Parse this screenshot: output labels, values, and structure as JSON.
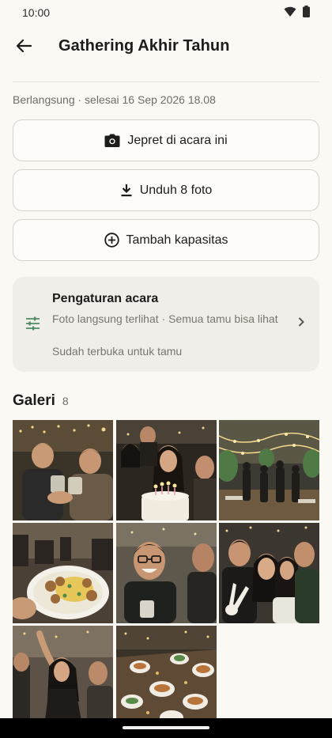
{
  "status_bar": {
    "time": "10:00"
  },
  "header": {
    "title": "Gathering Akhir Tahun"
  },
  "event": {
    "status": "Berlangsung · selesai 16 Sep 2026 18.08"
  },
  "actions": [
    {
      "label": "Jepret di acara ini",
      "icon": "camera-icon"
    },
    {
      "label": "Unduh 8 foto",
      "icon": "download-icon"
    },
    {
      "label": "Tambah kapasitas",
      "icon": "add-circle-icon"
    }
  ],
  "settings": {
    "title": "Pengaturan acara",
    "description": "Foto langsung terlihat · Semua tamu bisa lihat",
    "open_status": "Sudah terbuka untuk tamu"
  },
  "gallery": {
    "title": "Galeri",
    "count": "8",
    "photos": [
      {
        "subject": "friends toasting with drinks"
      },
      {
        "subject": "woman with birthday cake and candles"
      },
      {
        "subject": "restaurant hall with string lights"
      },
      {
        "subject": "plate of food"
      },
      {
        "subject": "man laughing"
      },
      {
        "subject": "group selfie with peace signs"
      },
      {
        "subject": "woman dancing"
      },
      {
        "subject": "dinner table with dishes"
      }
    ]
  },
  "colors": {
    "background": "#fbf9f4",
    "accent_green": "#4b8a63",
    "card": "#f0eee8",
    "border": "#d5d2cb"
  }
}
